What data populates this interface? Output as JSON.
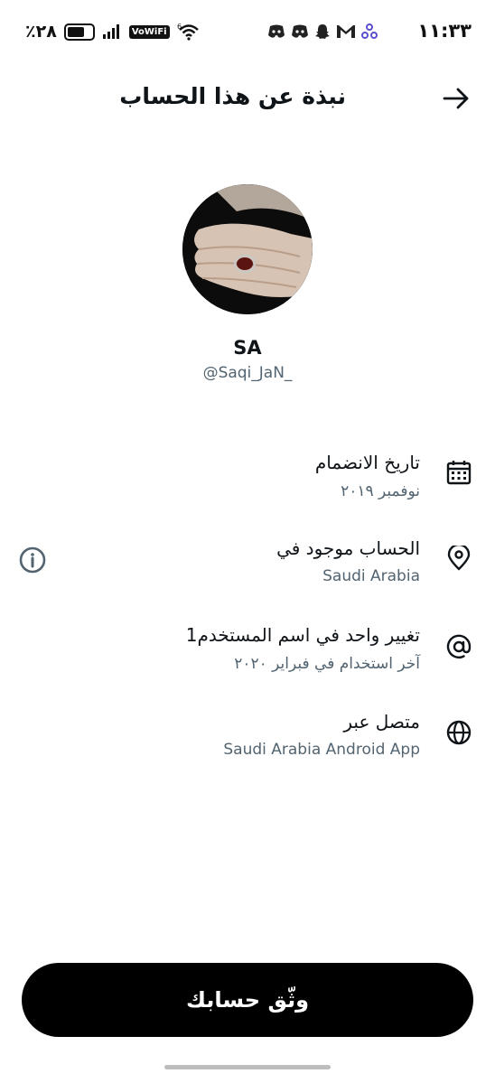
{
  "status_bar": {
    "time": "١١:٣٣",
    "battery_percent": "٪٢٨",
    "network": "VoWiFi",
    "signal_type": "6",
    "icons": [
      "discord-icon",
      "discord-icon",
      "snapchat-icon",
      "gmail-icon",
      "sync-icon",
      "signal-bars-icon",
      "wifi-icon",
      "battery-icon"
    ]
  },
  "header": {
    "title": "نبذة عن هذا الحساب",
    "back_icon": "arrow-right-icon"
  },
  "profile": {
    "display_name": "SA",
    "handle": "@Saqi_JaN_"
  },
  "details": [
    {
      "icon": "calendar-icon",
      "title": "تاريخ الانضمام",
      "subtitle": "نوفمبر ٢٠١٩"
    },
    {
      "icon": "location-pin-icon",
      "title": "الحساب موجود في",
      "subtitle": "Saudi Arabia",
      "info_icon": "info-icon"
    },
    {
      "icon": "at-sign-icon",
      "title": "تغيير واحد في اسم المستخدم1",
      "subtitle": "آخر استخدام في فبراير ٢٠٢٠"
    },
    {
      "icon": "globe-icon",
      "title": "متصل عبر",
      "subtitle": "Saudi Arabia Android App"
    }
  ],
  "verify_button": {
    "label": "وثّق حسابك"
  }
}
